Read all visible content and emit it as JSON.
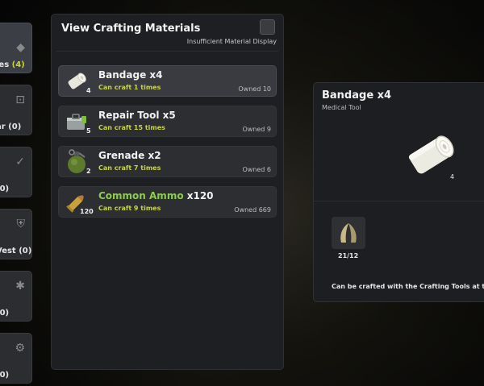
{
  "categories": [
    {
      "label": "les",
      "count": "(4)",
      "icon": "consumables-icon"
    },
    {
      "label": "ar",
      "count": "(0)",
      "icon": "gear-icon"
    },
    {
      "label": "",
      "count": "(0)",
      "icon": "weapon-icon"
    },
    {
      "label": "Vest",
      "count": "(0)",
      "icon": "vest-icon"
    },
    {
      "label": "",
      "count": "(0)",
      "icon": "tactical-icon"
    },
    {
      "label": "",
      "count": "(0)",
      "icon": "misc-icon"
    }
  ],
  "panel": {
    "title": "View Crafting Materials",
    "insufficient_label": "Insufficient Material Display"
  },
  "items": [
    {
      "name": "Bandage x4",
      "name_main": "Bandage",
      "name_qty": " x4",
      "qty": "4",
      "craft": "Can craft 1 times",
      "owned": "Owned 10",
      "icon": "bandage-icon"
    },
    {
      "name_main": "Repair Tool",
      "name_qty": " x5",
      "qty": "5",
      "craft": "Can craft 15 times",
      "owned": "Owned 9",
      "icon": "repair-tool-icon"
    },
    {
      "name_main": "Grenade",
      "name_qty": " x2",
      "qty": "2",
      "craft": "Can craft 7 times",
      "owned": "Owned 6",
      "icon": "grenade-icon"
    },
    {
      "name_main": "Common Ammo",
      "name_qty": " x120",
      "qty": "120",
      "craft": "Can craft 9 times",
      "owned": "Owned 669",
      "icon": "ammo-icon"
    }
  ],
  "detail": {
    "title": "Bandage x4",
    "subtitle": "Medical Tool",
    "image_count": "4",
    "material_count": "21/12",
    "material_icon": "fiber-icon",
    "note": "Can be crafted with the Crafting Tools at the"
  },
  "colors": {
    "accent_yellow": "#c9d63b",
    "accent_green": "#8ecb4e"
  }
}
